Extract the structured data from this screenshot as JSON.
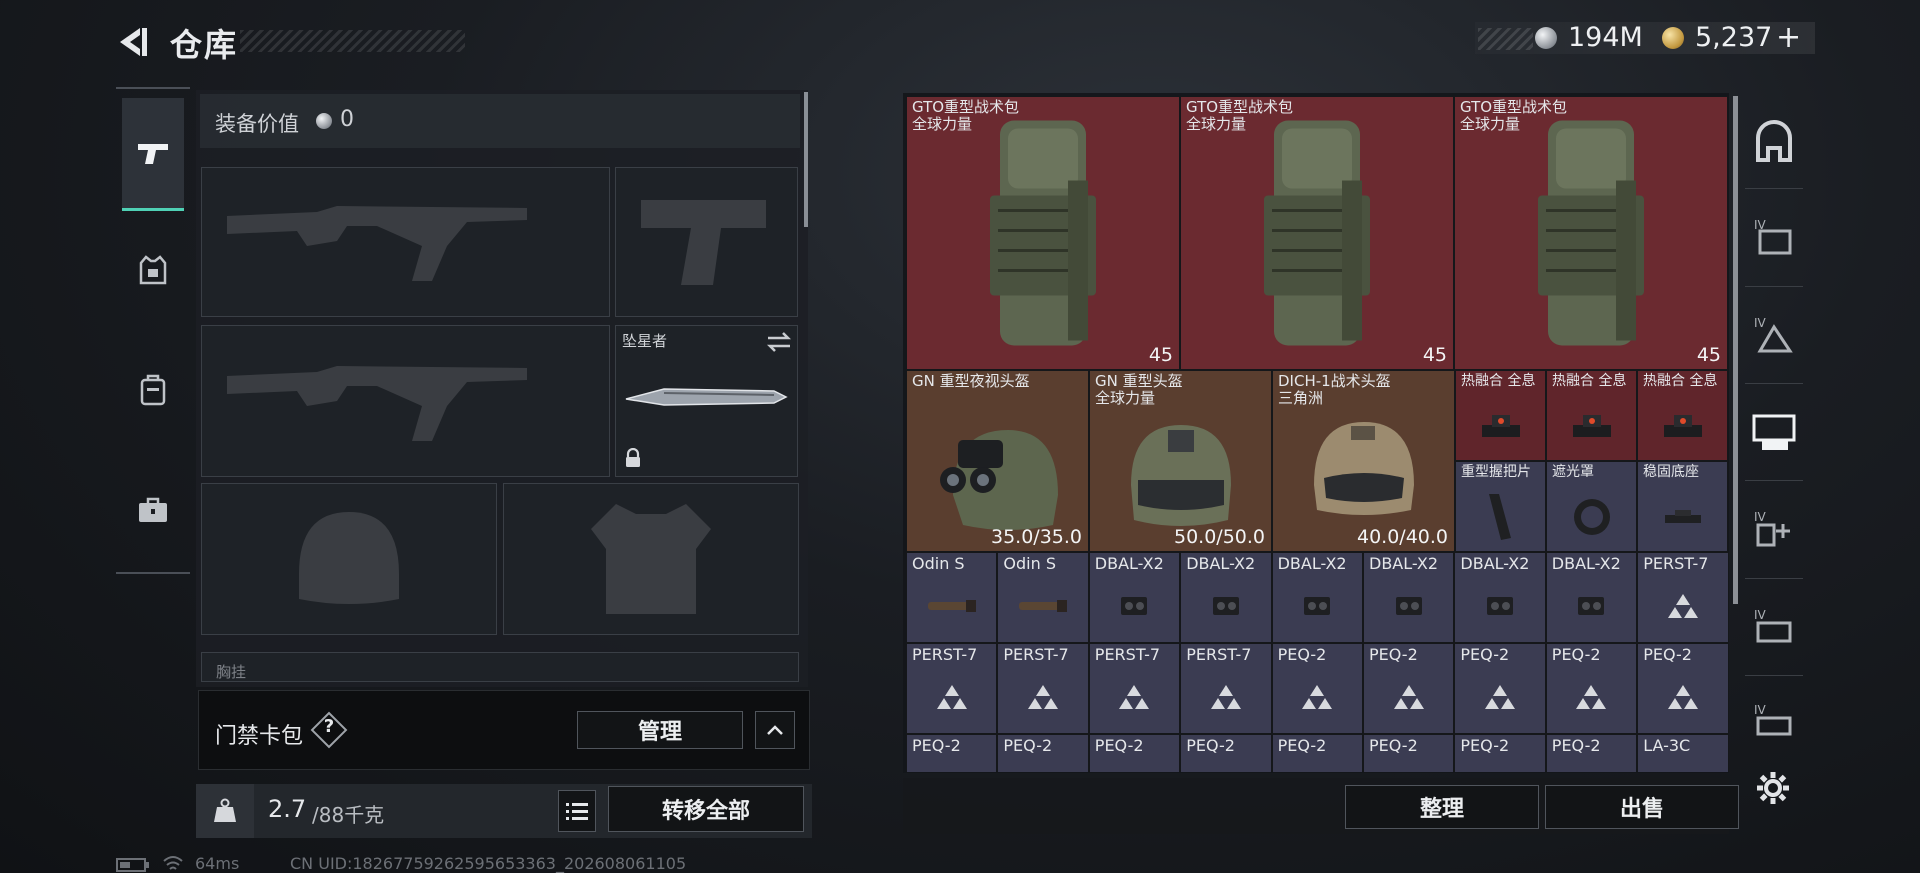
{
  "header": {
    "title": "仓库"
  },
  "currency": {
    "silver": "194M",
    "gold": "5,237",
    "add": "+"
  },
  "equipment": {
    "value_label": "装备价值",
    "value": "0",
    "melee_name": "坠星者",
    "chest_label": "胸挂"
  },
  "cardpack": {
    "label": "门禁卡包",
    "help": "?",
    "manage_label": "管理"
  },
  "capacity": {
    "current": "2.7",
    "max": "/88千克",
    "transfer_label": "转移全部"
  },
  "inventory": {
    "backpacks": [
      {
        "name": "GTO重型战术包",
        "sub": "全球力量",
        "count": "45"
      },
      {
        "name": "GTO重型战术包",
        "sub": "全球力量",
        "count": "45"
      },
      {
        "name": "GTO重型战术包",
        "sub": "全球力量",
        "count": "45"
      }
    ],
    "helmets": [
      {
        "name": "GN 重型夜视头盔",
        "sub": "",
        "durability": "35.0/35.0"
      },
      {
        "name": "GN 重型头盔",
        "sub": "全球力量",
        "durability": "50.0/50.0"
      },
      {
        "name": "DICH-1战术头盔",
        "sub": "三角洲",
        "durability": "40.0/40.0"
      }
    ],
    "sights": [
      "热融合 全息",
      "热融合 全息",
      "热融合 全息"
    ],
    "accessories": [
      "重型握把片",
      "遮光罩",
      "稳固底座"
    ],
    "row3": [
      "Odin S",
      "Odin S",
      "DBAL-X2",
      "DBAL-X2",
      "DBAL-X2",
      "DBAL-X2",
      "DBAL-X2",
      "DBAL-X2",
      "PERST-7"
    ],
    "row4": [
      "PERST-7",
      "PERST-7",
      "PERST-7",
      "PERST-7",
      "PEQ-2",
      "PEQ-2",
      "PEQ-2",
      "PEQ-2",
      "PEQ-2"
    ],
    "row5": [
      "PEQ-2",
      "PEQ-2",
      "PEQ-2",
      "PEQ-2",
      "PEQ-2",
      "PEQ-2",
      "PEQ-2",
      "PEQ-2",
      "LA-3C"
    ]
  },
  "actions": {
    "sort_label": "整理",
    "sell_label": "出售"
  },
  "status": {
    "ping": "64ms",
    "uid": "CN UID:18267759262595653363_202608061105"
  }
}
